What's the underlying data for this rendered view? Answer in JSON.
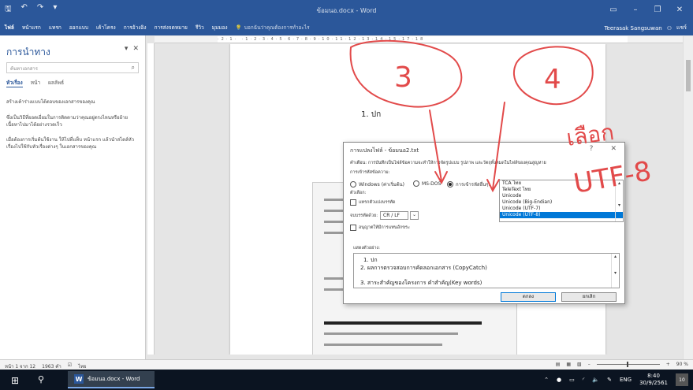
{
  "window": {
    "title": "ข้อมนอ.docx - Word"
  },
  "ribbon": {
    "tabs": [
      "ไฟล์",
      "หน้าแรก",
      "แทรก",
      "ออกแบบ",
      "เค้าโครง",
      "การอ้างอิง",
      "การส่งจดหมาย",
      "รีวิว",
      "มุมมอง"
    ],
    "tell_me": "บอกฉันว่าคุณต้องการทำอะไร",
    "user": "Teerasak Sangsuwan",
    "share": "แชร์"
  },
  "nav": {
    "title": "การนำทาง",
    "search_placeholder": "ค้นหาเอกสาร",
    "tabs": [
      "หัวเรื่อง",
      "หน้า",
      "ผลลัพธ์"
    ],
    "paragraphs": [
      "สร้างเค้าร่างแบบโต้ตอบของเอกสารของคุณ",
      "ซึ่งเป็นวิธีที่ยอดเยี่ยมในการติดตามว่าคุณอยู่ตรงไหนหรือย้ายเนื้อหาไปมาได้อย่างรวดเร็ว",
      "เมื่อต้องการเริ่มต้นใช้งาน ให้ไปที่แท็บ หน้าแรก แล้วนำสไตล์หัวเรื่องไปใช้กับหัวเรื่องต่างๆ ในเอกสารของคุณ"
    ]
  },
  "ruler": {
    "ticks": "·2·1· ·1·2·3·4·5·6·7·8·9·10·11·12·13·14·15·17·18"
  },
  "document": {
    "heading": "1. ปก"
  },
  "dialog": {
    "title": "การแปลงไฟล์ - ข้อมนอ2.txt",
    "warning": "คำเตือน: การบันทึกเป็นไฟล์ข้อความจะทำให้การจัดรูปแบบ รูปภาพ และวัตถุทั้งหมดในไฟล์ของคุณสูญหาย",
    "encoding_label": "การเข้ารหัสข้อความ:",
    "radio_windows": "Windows (ค่าเริ่มต้น)",
    "radio_msdos": "MS-DOS",
    "radio_other": "การเข้ารหัสอื่นๆ:",
    "encodings": [
      "TCA ไทย",
      "TeleText ไทย",
      "Unicode",
      "Unicode (Big-Endian)",
      "Unicode (UTF-7)",
      "Unicode (UTF-8)"
    ],
    "options_label": "ตัวเลือก:",
    "insert_breaks": "แทรกตัวแบ่งบรรทัด",
    "end_lines_label": "จบบรรทัดด้วย:",
    "end_lines_value": "CR / LF",
    "allow_substitution": "อนุญาตให้มีการแทนอักขระ",
    "preview_label": "แสดงตัวอย่าง:",
    "preview_lines": [
      "1. ปก",
      "2. ผลการตรวจสอบการคัดลอกเอกสาร (CopyCatch)",
      "3. สาระสำคัญของโครงการ คำสำคัญ(Key words)"
    ],
    "ok": "ตกลง",
    "cancel": "ยกเลิก"
  },
  "status": {
    "page": "หน้า 1 จาก 12",
    "words": "1963 คำ",
    "language": "ไทย",
    "zoom": "90 %"
  },
  "taskbar": {
    "app": "ข้อมนอ.docx - Word",
    "lang": "ENG",
    "time": "8:40",
    "date": "30/9/2561",
    "notifications": "10"
  },
  "annotations": {
    "three": "3",
    "four": "4",
    "choose": "เลือก",
    "utf": "UTF-8"
  },
  "colors": {
    "word_blue": "#2b579a",
    "ink_red": "#e24a4a",
    "selection": "#0078d7"
  }
}
